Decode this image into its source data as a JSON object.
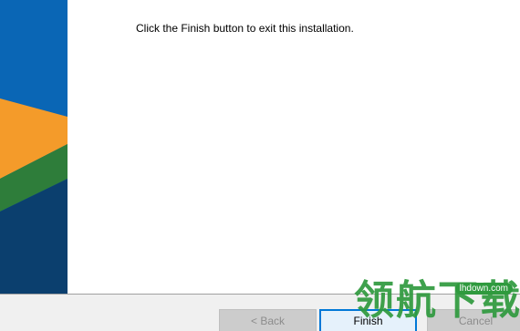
{
  "main": {
    "message": "Click the Finish button to exit this installation."
  },
  "buttons": {
    "back_label": "< Back",
    "finish_label": "Finish",
    "cancel_label": "Cancel"
  },
  "watermark": {
    "text": "领航下载",
    "badge": "lhdown.com"
  },
  "colors": {
    "banner_blue": "#0a66b5",
    "banner_orange": "#f49b2a",
    "banner_green": "#2e7d3a",
    "banner_navy": "#0b3f6e",
    "accent": "#0078d7",
    "watermark_green": "#2f9a3e"
  }
}
